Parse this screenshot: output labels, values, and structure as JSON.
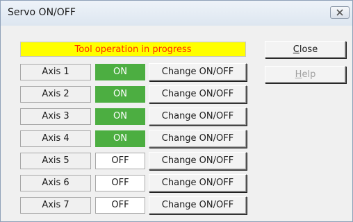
{
  "window": {
    "title": "Servo ON/OFF",
    "close_icon": "close-x-icon"
  },
  "banner": {
    "text": "Tool operation in progress",
    "background": "#ffff00",
    "color": "#ff2a00"
  },
  "axes": [
    {
      "label": "Axis 1",
      "state": "ON",
      "button": "Change ON/OFF"
    },
    {
      "label": "Axis 2",
      "state": "ON",
      "button": "Change ON/OFF"
    },
    {
      "label": "Axis 3",
      "state": "ON",
      "button": "Change ON/OFF"
    },
    {
      "label": "Axis 4",
      "state": "ON",
      "button": "Change ON/OFF"
    },
    {
      "label": "Axis 5",
      "state": "OFF",
      "button": "Change ON/OFF"
    },
    {
      "label": "Axis 6",
      "state": "OFF",
      "button": "Change ON/OFF"
    },
    {
      "label": "Axis 7",
      "state": "OFF",
      "button": "Change ON/OFF"
    }
  ],
  "buttons": {
    "close_access": "C",
    "close_rest": "lose",
    "help_access": "H",
    "help_rest": "elp"
  },
  "colors": {
    "on_state": "#4cae41"
  }
}
